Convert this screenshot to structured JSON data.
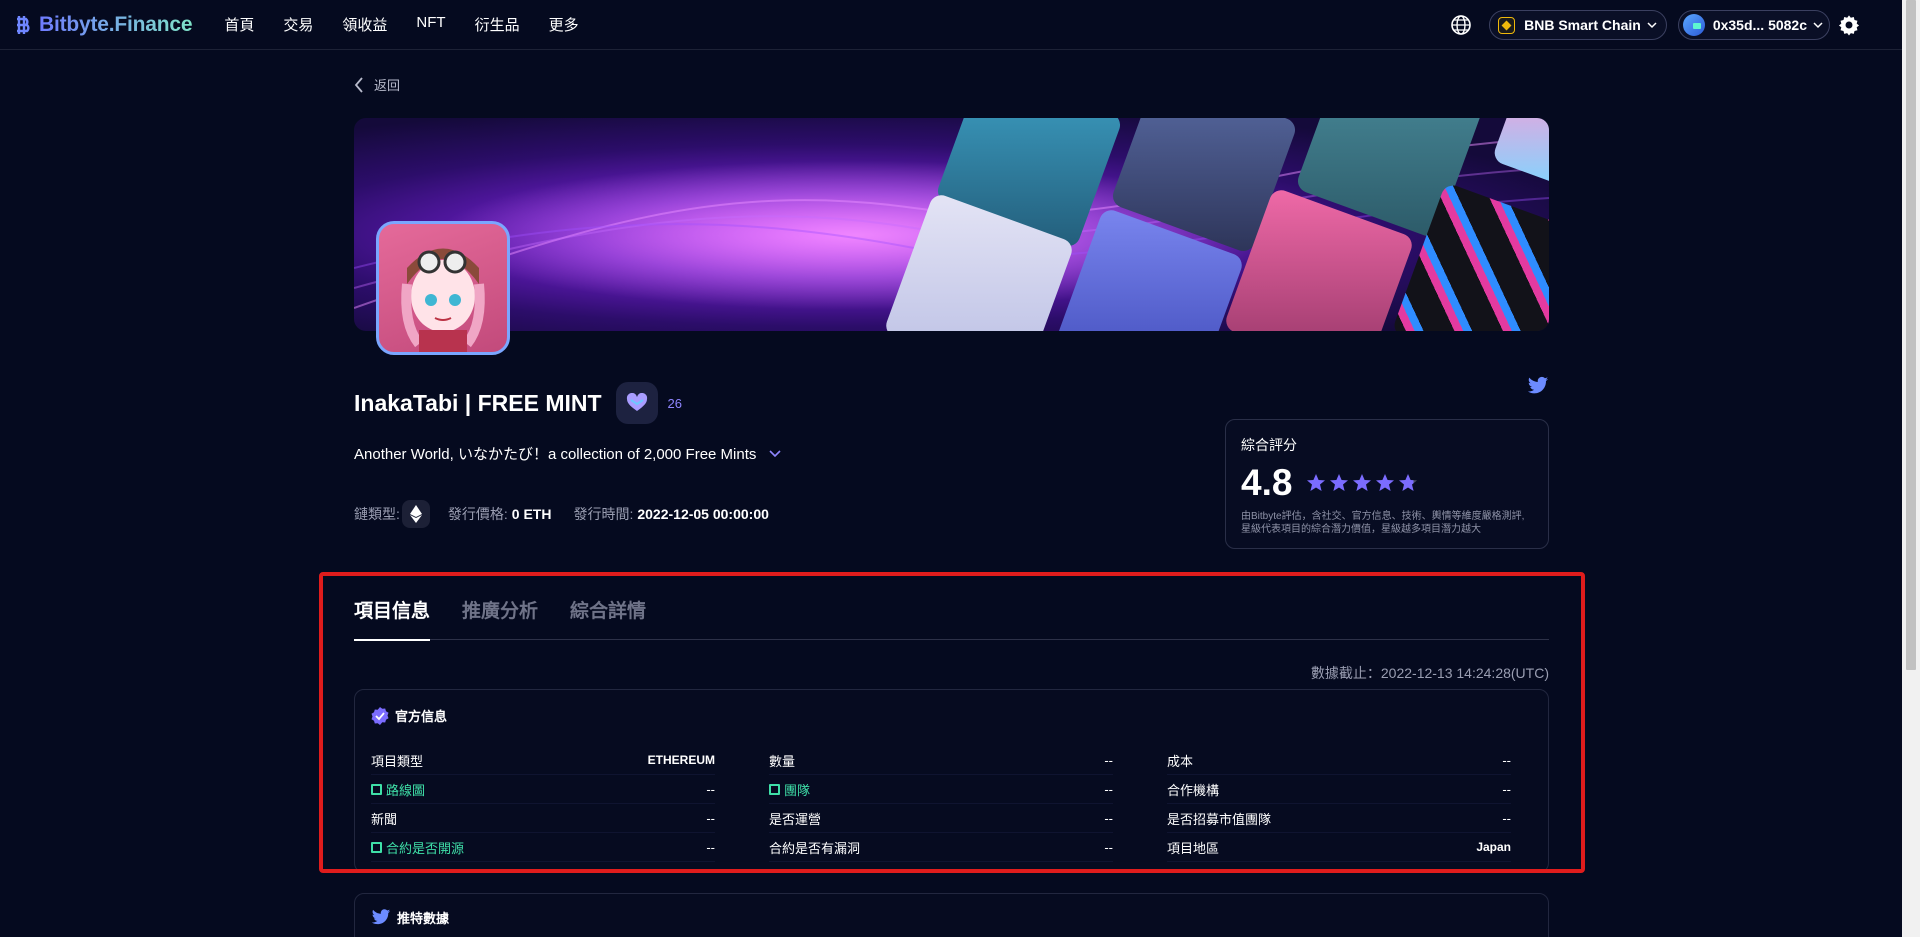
{
  "app": {
    "name": "Bitbyte.Finance"
  },
  "nav": {
    "items": [
      "首頁",
      "交易",
      "領收益",
      "NFT",
      "衍生品",
      "更多"
    ]
  },
  "header": {
    "chain": "BNB Smart Chain",
    "wallet": "0x35d... 5082c"
  },
  "back_label": "返回",
  "project": {
    "name": "InakaTabi | FREE MINT",
    "likes": "26",
    "description": "Another World, いなかたび！a collection of 2,000 Free Mints",
    "chain_type_label": "鏈類型:",
    "price_label": "發行價格:",
    "price_value": "0 ETH",
    "time_label": "發行時間:",
    "time_value": "2022-12-05 00:00:00"
  },
  "rating": {
    "label": "綜合評分",
    "score": "4.8",
    "stars": 4.8,
    "note": "由Bitbyte評估，含社交、官方信息、技術、輿情等維度嚴格測評,星級代表項目的綜合潛力價值，星級越多項目潛力越大"
  },
  "tabs": [
    "項目信息",
    "推廣分析",
    "綜合詳情"
  ],
  "data_cutoff": "數據截止：2022-12-13 14:24:28(UTC)",
  "official_info": {
    "title": "官方信息",
    "columns": [
      [
        {
          "key": "項目類型",
          "value": "ETHEREUM",
          "link": false
        },
        {
          "key": "路線圖",
          "value": "--",
          "link": true
        },
        {
          "key": "新聞",
          "value": "--",
          "link": false
        },
        {
          "key": "合約是否開源",
          "value": "--",
          "link": true
        }
      ],
      [
        {
          "key": "數量",
          "value": "--",
          "link": false
        },
        {
          "key": "團隊",
          "value": "--",
          "link": true
        },
        {
          "key": "是否運營",
          "value": "--",
          "link": false
        },
        {
          "key": "合約是否有漏洞",
          "value": "--",
          "link": false
        }
      ],
      [
        {
          "key": "成本",
          "value": "--",
          "link": false
        },
        {
          "key": "合作機構",
          "value": "--",
          "link": false
        },
        {
          "key": "是否招募市值團隊",
          "value": "--",
          "link": false
        },
        {
          "key": "項目地區",
          "value": "Japan",
          "link": false
        }
      ]
    ]
  },
  "twitter_panel": {
    "title": "推特數據"
  },
  "icons": [
    "logo-icon",
    "globe-icon",
    "bnb-chain-icon",
    "chevron-down-icon",
    "wallet-avatar-icon",
    "gear-icon",
    "chevron-left-icon",
    "heart-icon",
    "twitter-icon",
    "ethereum-icon",
    "star-icon",
    "verified-badge-icon"
  ],
  "colors": {
    "background": "#050a1f",
    "accent": "#7b6cff",
    "link_green": "#3fe0a8",
    "highlight_red": "#e01c1c"
  }
}
